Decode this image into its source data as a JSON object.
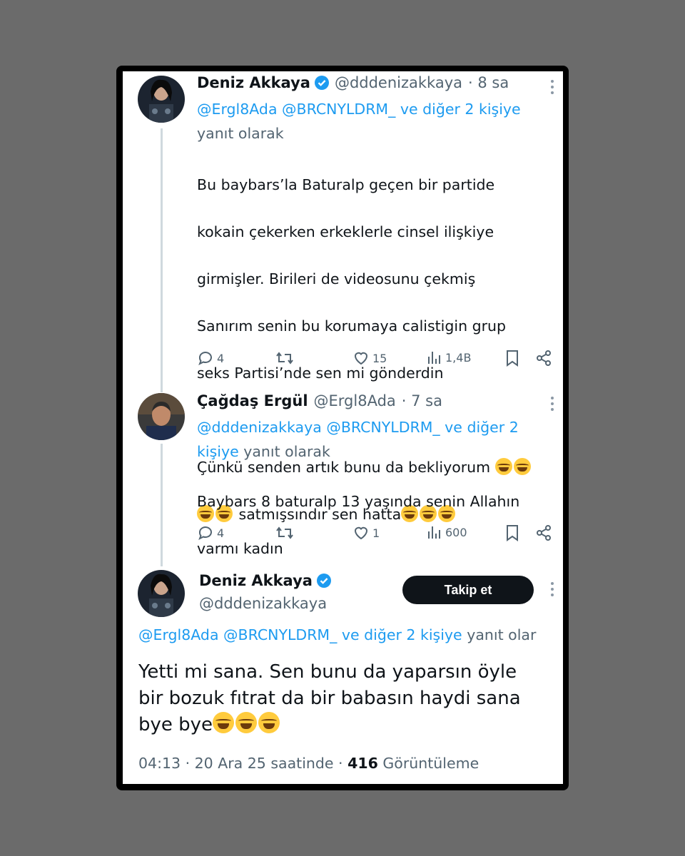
{
  "tweet1": {
    "name": "Deniz Akkaya",
    "handle": "@dddenizakkaya",
    "time": "· 8 sa",
    "reply_mentions": "@Ergl8Ada @BRCNYLDRM_ ve diğer 2 kişiye",
    "reply_suffix": "yanıt olarak",
    "body_line1": "Bu baybars’la Baturalp geçen bir partide",
    "body_line2": "kokain çekerken erkeklerle cinsel ilişkiye",
    "body_line3": "girmişler. Birileri de videosunu çekmiş",
    "body_line4": "Sanırım senin bu korumaya calistigin grup",
    "body_line5": "seks Partisi’nde sen mi gönderdin",
    "body_line6": "Çünkü senden artık bunu da bekliyorum",
    "body_line7": "satmışsındır sen hatta",
    "replies": "4",
    "likes": "15",
    "views": "1,4B"
  },
  "tweet2": {
    "name": "Çağdaş Ergül",
    "handle": "@Ergl8Ada",
    "time": "· 7 sa",
    "reply_mentions_a": "@dddenizakkaya @BRCNYLDRM_ ve diğer 2",
    "reply_mentions_b": "kişiye",
    "reply_suffix": "yanıt olarak",
    "body_line1": "Baybars 8 baturalp 13 yaşında senin Allahın",
    "body_line2": "varmı kadın",
    "replies": "4",
    "likes": "1",
    "views": "600"
  },
  "tweet3": {
    "name": "Deniz Akkaya",
    "handle": "@dddenizakkaya",
    "follow_label": "Takip et",
    "reply_mentions": "@Ergl8Ada @BRCNYLDRM_ ve diğer 2 kişiye",
    "reply_suffix": "yanıt olar",
    "body_line1": "Yetti mi sana. Sen bunu da yaparsın öyle",
    "body_line2": "bir bozuk fıtrat da bir babasın haydi sana",
    "body_line3": "bye bye",
    "time": "04:13 · 20 Ara 25 saatinde ·",
    "views_count": "416",
    "views_label": "Görüntüleme"
  },
  "colors": {
    "accent": "#1d9bf0",
    "text": "#0f1419",
    "muted": "#536471",
    "verified": "#1d9bf0"
  },
  "icons": [
    "reply-icon",
    "retweet-icon",
    "like-icon",
    "views-icon",
    "bookmark-icon",
    "share-icon",
    "verified-icon",
    "more-icon",
    "laughing-emoji"
  ]
}
